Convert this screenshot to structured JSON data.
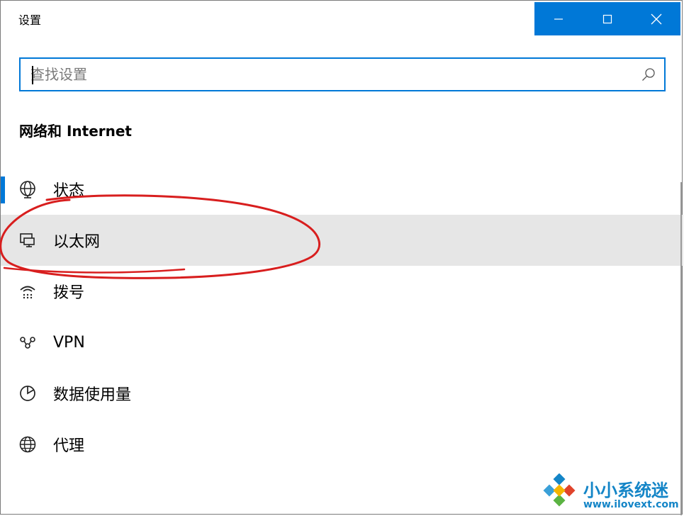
{
  "window": {
    "title": "设置",
    "controls": [
      "minimize-icon",
      "maximize-icon",
      "close-icon"
    ],
    "accent_color": "#0078d7"
  },
  "search": {
    "placeholder": "查找设置",
    "value": "",
    "icon": "search-icon"
  },
  "section": {
    "title": "网络和 Internet"
  },
  "nav": {
    "items": [
      {
        "label": "状态",
        "icon": "globe-status-icon",
        "selected": true
      },
      {
        "label": "以太网",
        "icon": "ethernet-icon",
        "hovered": true
      },
      {
        "label": "拨号",
        "icon": "dialup-icon"
      },
      {
        "label": "VPN",
        "icon": "vpn-icon"
      },
      {
        "label": "数据使用量",
        "icon": "data-usage-icon"
      },
      {
        "label": "代理",
        "icon": "globe-proxy-icon"
      }
    ]
  },
  "watermark": {
    "brand": "小小系统迷",
    "url": "www.ilovext.com",
    "color": "#1485c7"
  },
  "annotation": {
    "color": "#d81e1e",
    "shape": "hand-drawn-circle"
  }
}
